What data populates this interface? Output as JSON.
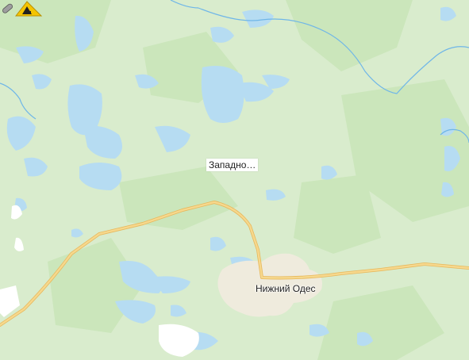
{
  "map": {
    "poi": {
      "label": "Западно…",
      "icon": "quarry-excavator-icon"
    },
    "settlement": {
      "label": "Нижний Одес"
    }
  },
  "colors": {
    "land": "#d9eccd",
    "forest": "#c9e6b9",
    "water": "#b6dcf2",
    "river": "#6fb6e8",
    "road": "#f2cf7c",
    "road_edge": "#e7b85c",
    "settlement": "#efebdd",
    "snow": "#ffffff",
    "poi_yellow": "#f5c400"
  }
}
